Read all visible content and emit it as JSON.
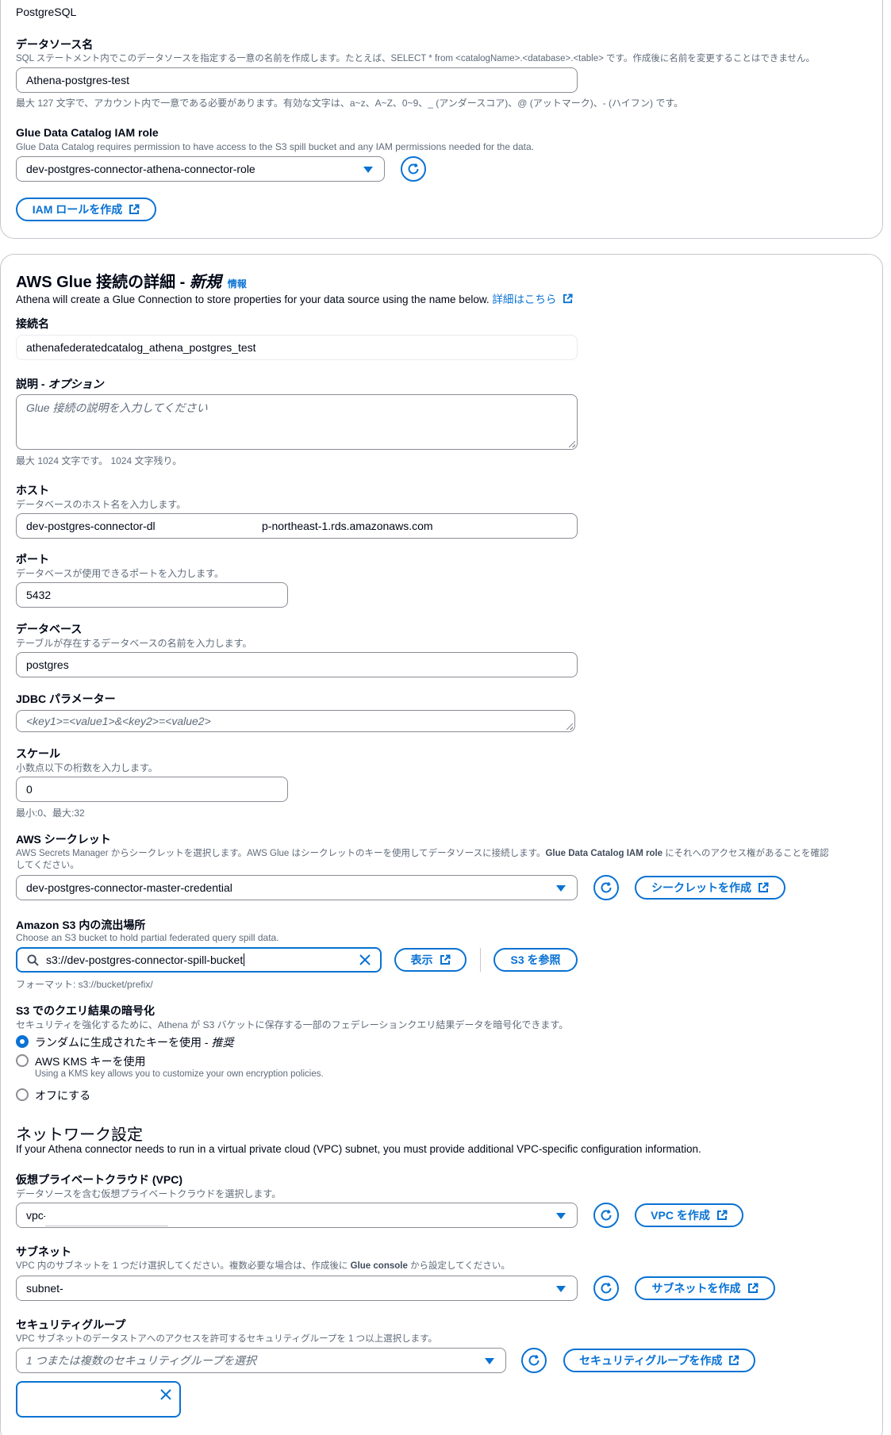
{
  "section1": {
    "engine_label": "PostgreSQL",
    "datasource_name": {
      "label": "データソース名",
      "description": "SQL ステートメント内でこのデータソースを指定する一意の名前を作成します。たとえば、SELECT * from <catalogName>.<database>.<table> です。作成後に名前を変更することはできません。",
      "value": "Athena-postgres-test",
      "hint": "最大 127 文字で、アカウント内で一意である必要があります。有効な文字は、a~z、A~Z、0~9、_ (アンダースコア)、@ (アットマーク)、- (ハイフン) です。"
    },
    "iam_role": {
      "label": "Glue Data Catalog IAM role",
      "description": "Glue Data Catalog requires permission to have access to the S3 spill bucket and any IAM permissions needed for the data.",
      "value": "dev-postgres-connector-athena-connector-role",
      "create_button": "IAM ロールを作成"
    }
  },
  "section2": {
    "title_main": "AWS Glue 接続の詳細 - ",
    "title_em": "新規",
    "info_link": "情報",
    "subtitle": "Athena will create a Glue Connection to store properties for your data source using the name below. ",
    "learn_more": "詳細はこちら",
    "connection_name": {
      "label": "接続名",
      "value": "athenafederatedcatalog_athena_postgres_test"
    },
    "description_field": {
      "label_main": "説明 - ",
      "label_em": "オプション",
      "placeholder": "Glue 接続の説明を入力してください",
      "hint": "最大 1024 文字です。 1024 文字残り。"
    },
    "host": {
      "label": "ホスト",
      "description": "データベースのホスト名を入力します。",
      "value_start": "dev-postgres-connector-dl",
      "value_end": "p-northeast-1.rds.amazonaws.com"
    },
    "port": {
      "label": "ポート",
      "description": "データベースが使用できるポートを入力します。",
      "value": "5432"
    },
    "database": {
      "label": "データベース",
      "description": "テーブルが存在するデータベースの名前を入力します。",
      "value": "postgres"
    },
    "jdbc": {
      "label": "JDBC パラメーター",
      "placeholder": "<key1>=<value1>&<key2>=<value2>"
    },
    "scale": {
      "label": "スケール",
      "description": "小数点以下の桁数を入力します。",
      "value": "0",
      "hint": "最小:0、最大:32"
    },
    "secret": {
      "label": "AWS シークレット",
      "description": "AWS Secrets Manager からシークレットを選択します。AWS Glue はシークレットのキーを使用してデータソースに接続します。",
      "description_bold": "Glue Data Catalog IAM role",
      "description_end": " にそれへのアクセス権があることを確認",
      "description_line2": "してください。",
      "value": "dev-postgres-connector-master-credential",
      "create_button": "シークレットを作成"
    },
    "spill": {
      "label": "Amazon S3 内の流出場所",
      "description": "Choose an S3 bucket to hold partial federated query spill data.",
      "value": "s3://dev-postgres-connector-spill-bucket",
      "view_button": "表示",
      "browse_button": "S3 を参照",
      "hint": "フォーマット: s3://bucket/prefix/"
    },
    "encryption": {
      "label": "S3 でのクエリ結果の暗号化",
      "description": "セキュリティを強化するために、Athena が S3 バケットに保存する一部のフェデレーションクエリ結果データを暗号化できます。",
      "options": [
        {
          "label": "ランダムに生成されたキーを使用 - ",
          "em": "推奨",
          "selected": true
        },
        {
          "label": "AWS KMS キーを使用",
          "sub": "Using a KMS key allows you to customize your own encryption policies.",
          "selected": false
        },
        {
          "label": "オフにする",
          "selected": false
        }
      ]
    },
    "network": {
      "title": "ネットワーク設定",
      "description": "If your Athena connector needs to run in a virtual private cloud (VPC) subnet, you must provide additional VPC-specific configuration information.",
      "vpc": {
        "label": "仮想プライベートクラウド (VPC)",
        "description": "データソースを含む仮想プライベートクラウドを選択します。",
        "value": "vpc-",
        "create_button": "VPC を作成"
      },
      "subnet": {
        "label": "サブネット",
        "description_start": "VPC 内のサブネットを 1 つだけ選択してください。複数必要な場合は、作成後に ",
        "description_bold": "Glue console",
        "description_end": " から設定してください。",
        "value": "subnet-",
        "create_button": "サブネットを作成"
      },
      "security_group": {
        "label": "セキュリティグループ",
        "description": "VPC サブネットのデータストアへのアクセスを許可するセキュリティグループを 1 つ以上選択します。",
        "placeholder": "1 つまたは複数のセキュリティグループを選択",
        "create_button": "セキュリティグループを作成"
      }
    }
  }
}
